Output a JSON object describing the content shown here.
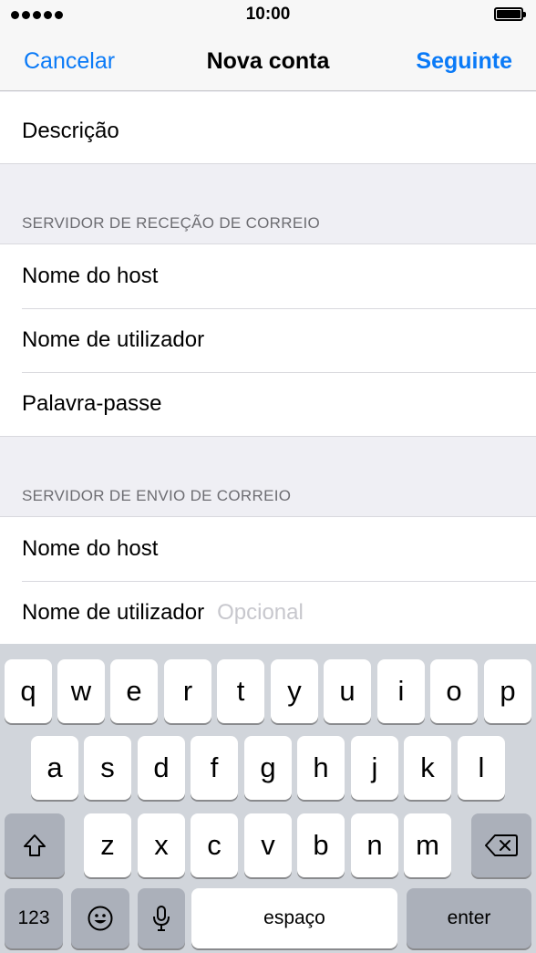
{
  "status_bar": {
    "time": "10:00"
  },
  "nav": {
    "cancel_label": "Cancelar",
    "title": "Nova conta",
    "next_label": "Seguinte"
  },
  "form": {
    "description_label": "Descrição",
    "incoming": {
      "header": "SERVIDOR DE RECEÇÃO DE CORREIO",
      "host_label": "Nome do host",
      "username_label": "Nome de utilizador",
      "password_label": "Palavra-passe"
    },
    "outgoing": {
      "header": "SERVIDOR DE ENVIO DE CORREIO",
      "host_label": "Nome do host",
      "username_label": "Nome de utilizador",
      "username_placeholder": "Opcional"
    }
  },
  "keyboard": {
    "row1": [
      "q",
      "w",
      "e",
      "r",
      "t",
      "y",
      "u",
      "i",
      "o",
      "p"
    ],
    "row2": [
      "a",
      "s",
      "d",
      "f",
      "g",
      "h",
      "j",
      "k",
      "l"
    ],
    "row3": [
      "z",
      "x",
      "c",
      "v",
      "b",
      "n",
      "m"
    ],
    "numbers_label": "123",
    "space_label": "espaço",
    "enter_label": "enter"
  },
  "colors": {
    "accent": "#0a7af7",
    "keyboard_bg": "#d1d5db",
    "placeholder": "#c7c7cd"
  }
}
